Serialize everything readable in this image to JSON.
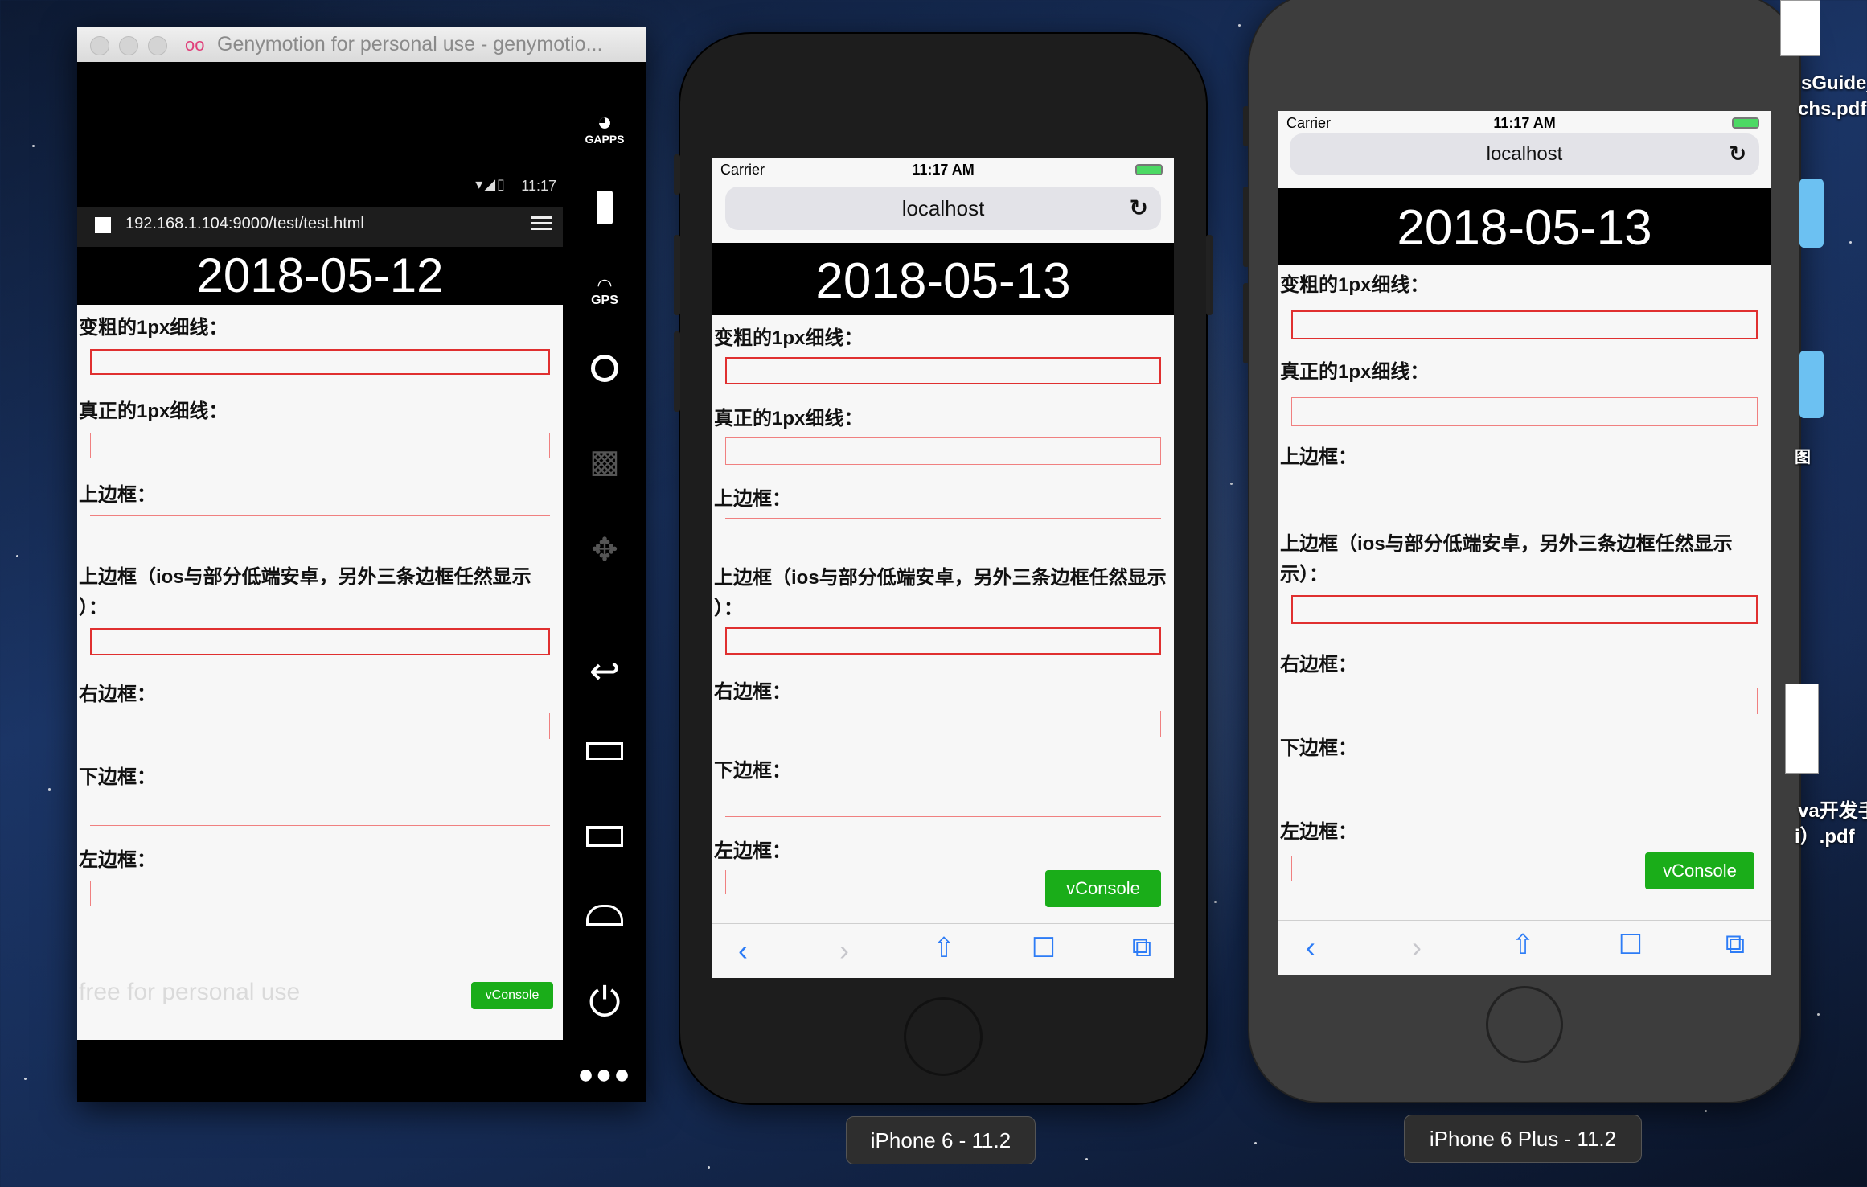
{
  "colors": {
    "accent_red": "#e02020",
    "vconsole_green": "#1aad19",
    "ios_blue": "#2d7cf6"
  },
  "genymotion": {
    "window_title": "Genymotion for personal use - genymotio...",
    "status_time": "11:17",
    "url": "192.168.1.104:9000/test/test.html",
    "date": "2018-05-12",
    "labels": [
      "变粗的1px细线：",
      "真正的1px细线：",
      "上边框：",
      "上边框（ios与部分低端安卓，另外三条边框任然显示",
      "）：",
      "右边框：",
      "下边框：",
      "左边框："
    ],
    "vconsole": "vConsole",
    "watermark": "free for personal use",
    "sidebar": {
      "gapps": "GAPPS",
      "gps": "GPS",
      "icons": [
        "gapps-icon",
        "battery-icon",
        "gps-icon",
        "camera-icon",
        "media-icon",
        "dpad-icon",
        "back-icon",
        "recent-apps-icon",
        "menu-icon",
        "home-icon",
        "power-icon",
        "more-icon"
      ]
    }
  },
  "iphone6": {
    "carrier": "Carrier",
    "time": "11:17 AM",
    "host": "localhost",
    "date": "2018-05-13",
    "labels": [
      "变粗的1px细线：",
      "真正的1px细线：",
      "上边框：",
      "上边框（ios与部分低端安卓，另外三条边框任然显示",
      "）：",
      "右边框：",
      "下边框：",
      "左边框："
    ],
    "vconsole": "vConsole",
    "device_label": "iPhone 6 - 11.2"
  },
  "iphone6plus": {
    "carrier": "Carrier",
    "time": "11:17 AM",
    "host": "localhost",
    "date": "2018-05-13",
    "labels": [
      "变粗的1px细线：",
      "真正的1px细线：",
      "上边框：",
      "上边框（ios与部分低端安卓，另外三条边框任然显示",
      "示）：",
      "右边框：",
      "下边框：",
      "左边框："
    ],
    "vconsole": "vConsole",
    "device_label": "iPhone 6 Plus - 11.2"
  },
  "desktop": {
    "files": [
      "sGuide_",
      "chs.pdf",
      "图",
      "va开发手",
      "i）.pdf"
    ]
  }
}
